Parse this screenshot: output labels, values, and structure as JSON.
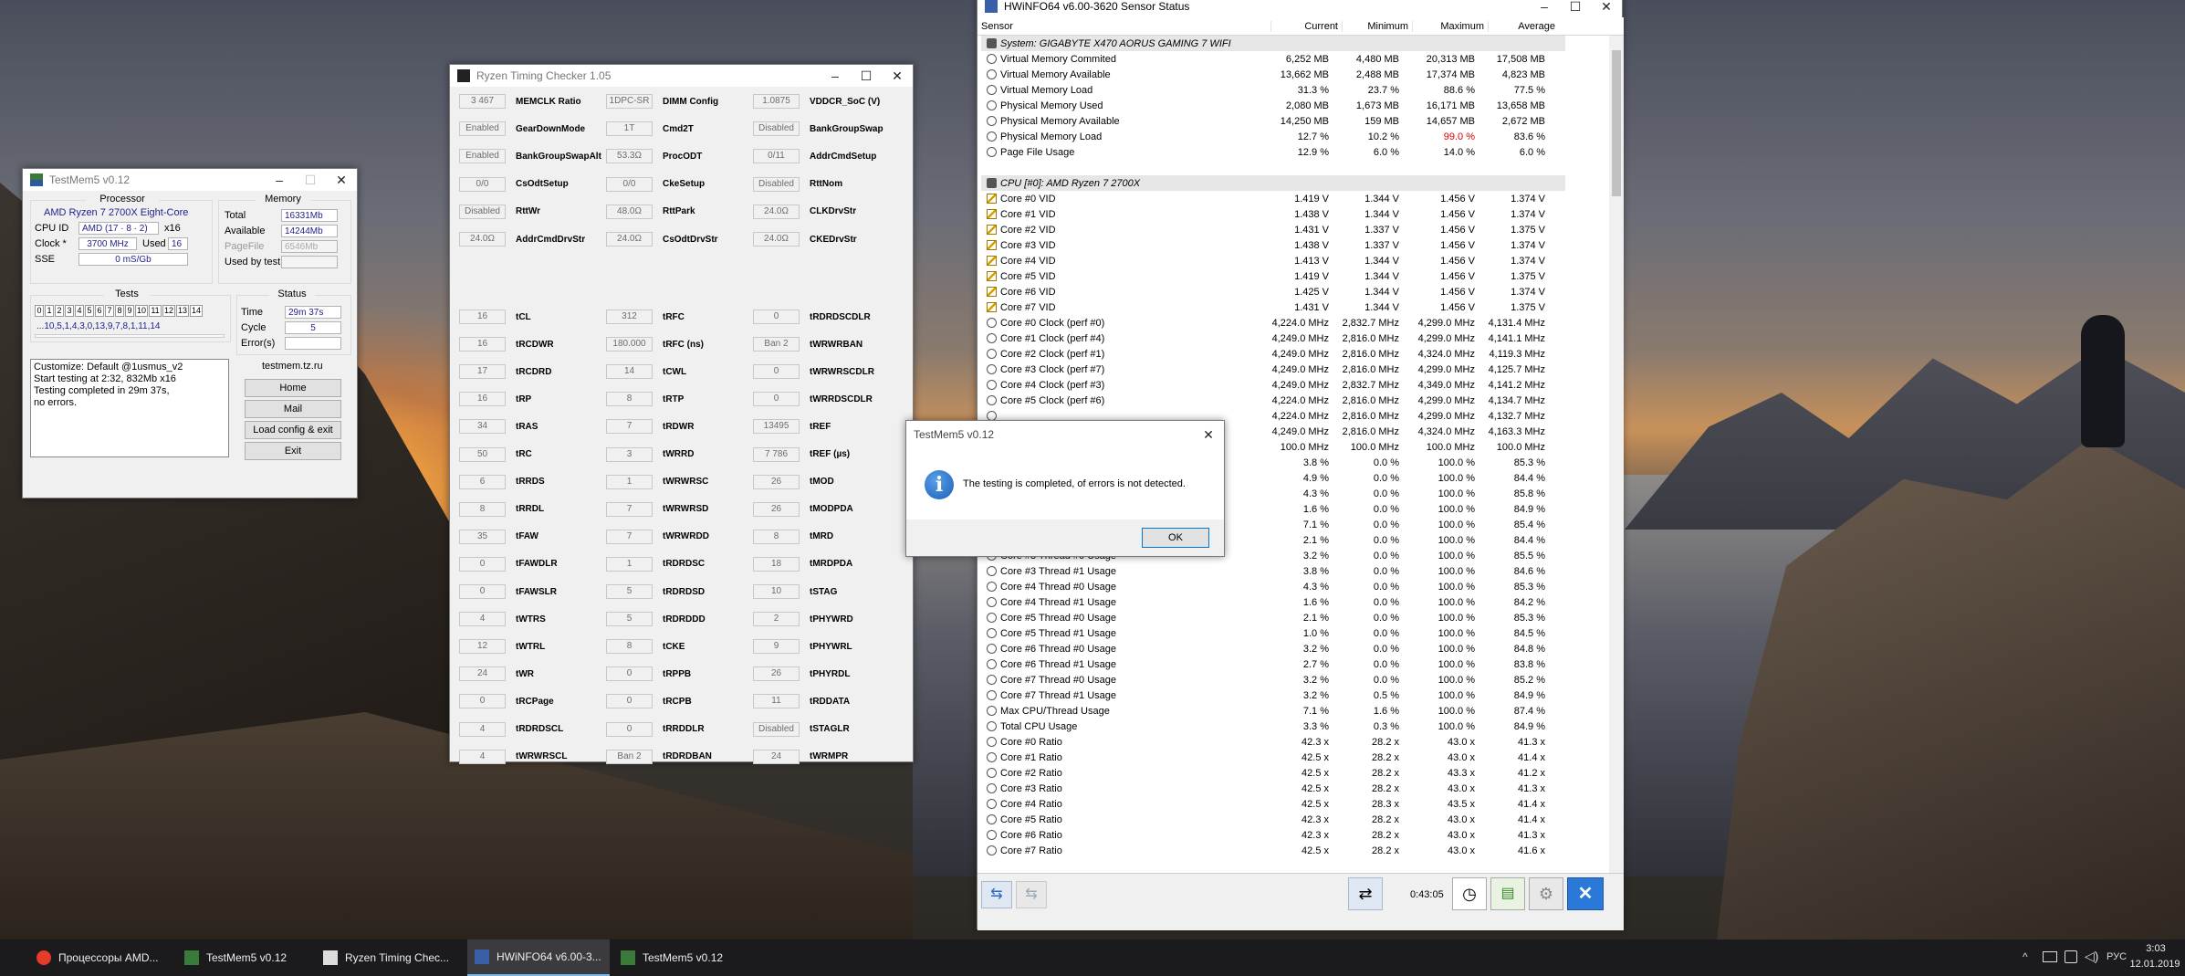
{
  "testmem": {
    "title": "TestMem5 v0.12",
    "processor_label": "Processor",
    "processor_name": "AMD Ryzen 7 2700X Eight-Core",
    "cpuid_label": "CPU ID",
    "cpuid_value": "AMD  (17 · 8 · 2)",
    "cpuid_extra": "x16",
    "clock_label": "Clock *",
    "clock_value": "3700 MHz",
    "used_label": "Used",
    "used_value": "16",
    "sse_label": "SSE",
    "sse_value": "0 mS/Gb",
    "memory_label": "Memory",
    "total_label": "Total",
    "total_value": "16331Mb",
    "available_label": "Available",
    "available_value": "14244Mb",
    "pagefile_label": "PageFile",
    "pagefile_value": "6546Mb",
    "usedbytest_label": "Used by test",
    "usedbytest_value": "",
    "tests_label": "Tests",
    "test_numbers": [
      "0",
      "1",
      "2",
      "3",
      "4",
      "5",
      "6",
      "7",
      "8",
      "9",
      "10",
      "11",
      "12",
      "13",
      "14"
    ],
    "test_sequence": "...10,5,1,4,3,0,13,9,7,8,1,11,14",
    "status_label": "Status",
    "time_label": "Time",
    "time_value": "29m 37s",
    "cycle_label": "Cycle",
    "cycle_value": "5",
    "errors_label": "Error(s)",
    "errors_value": "",
    "log_lines": [
      "Customize: Default @1usmus_v2",
      "Start testing at 2:32, 832Mb x16",
      "Testing completed in 29m 37s,",
      "no errors."
    ],
    "site": "testmem.tz.ru",
    "btn_home": "Home",
    "btn_mail": "Mail",
    "btn_load": "Load config & exit",
    "btn_exit": "Exit"
  },
  "rtc": {
    "title": "Ryzen Timing Checker 1.05",
    "top_rows": [
      [
        [
          "3 467",
          "MEMCLK Ratio"
        ],
        [
          "1DPC-SR",
          "DIMM Config"
        ],
        [
          "1.0875",
          "VDDCR_SoC (V)"
        ]
      ],
      [
        [
          "Enabled",
          "GearDownMode"
        ],
        [
          "1T",
          "Cmd2T"
        ],
        [
          "Disabled",
          "BankGroupSwap"
        ]
      ],
      [
        [
          "Enabled",
          "BankGroupSwapAlt"
        ],
        [
          "53.3Ω",
          "ProcODT"
        ],
        [
          "0/11",
          "AddrCmdSetup"
        ]
      ],
      [
        [
          "0/0",
          "CsOdtSetup"
        ],
        [
          "0/0",
          "CkeSetup"
        ],
        [
          "Disabled",
          "RttNom"
        ]
      ],
      [
        [
          "Disabled",
          "RttWr"
        ],
        [
          "48.0Ω",
          "RttPark"
        ],
        [
          "24.0Ω",
          "CLKDrvStr"
        ]
      ],
      [
        [
          "24.0Ω",
          "AddrCmdDrvStr"
        ],
        [
          "24.0Ω",
          "CsOdtDrvStr"
        ],
        [
          "24.0Ω",
          "CKEDrvStr"
        ]
      ]
    ],
    "timing_rows": [
      [
        [
          "16",
          "tCL"
        ],
        [
          "312",
          "tRFC"
        ],
        [
          "0",
          "tRDRDSCDLR"
        ]
      ],
      [
        [
          "16",
          "tRCDWR"
        ],
        [
          "180.000",
          "tRFC (ns)"
        ],
        [
          "Ban 2",
          "tWRWRBAN"
        ]
      ],
      [
        [
          "17",
          "tRCDRD"
        ],
        [
          "14",
          "tCWL"
        ],
        [
          "0",
          "tWRWRSCDLR"
        ]
      ],
      [
        [
          "16",
          "tRP"
        ],
        [
          "8",
          "tRTP"
        ],
        [
          "0",
          "tWRRDSCDLR"
        ]
      ],
      [
        [
          "34",
          "tRAS"
        ],
        [
          "7",
          "tRDWR"
        ],
        [
          "13495",
          "tREF"
        ]
      ],
      [
        [
          "50",
          "tRC"
        ],
        [
          "3",
          "tWRRD"
        ],
        [
          "7 786",
          "tREF (µs)"
        ]
      ],
      [
        [
          "6",
          "tRRDS"
        ],
        [
          "1",
          "tWRWRSC"
        ],
        [
          "26",
          "tMOD"
        ]
      ],
      [
        [
          "8",
          "tRRDL"
        ],
        [
          "7",
          "tWRWRSD"
        ],
        [
          "26",
          "tMODPDA"
        ]
      ],
      [
        [
          "35",
          "tFAW"
        ],
        [
          "7",
          "tWRWRDD"
        ],
        [
          "8",
          "tMRD"
        ]
      ],
      [
        [
          "0",
          "tFAWDLR"
        ],
        [
          "1",
          "tRDRDSC"
        ],
        [
          "18",
          "tMRDPDA"
        ]
      ],
      [
        [
          "0",
          "tFAWSLR"
        ],
        [
          "5",
          "tRDRDSD"
        ],
        [
          "10",
          "tSTAG"
        ]
      ],
      [
        [
          "4",
          "tWTRS"
        ],
        [
          "5",
          "tRDRDDD"
        ],
        [
          "2",
          "tPHYWRD"
        ]
      ],
      [
        [
          "12",
          "tWTRL"
        ],
        [
          "8",
          "tCKE"
        ],
        [
          "9",
          "tPHYWRL"
        ]
      ],
      [
        [
          "24",
          "tWR"
        ],
        [
          "0",
          "tRPPB"
        ],
        [
          "26",
          "tPHYRDL"
        ]
      ],
      [
        [
          "0",
          "tRCPage"
        ],
        [
          "0",
          "tRCPB"
        ],
        [
          "11",
          "tRDDATA"
        ]
      ],
      [
        [
          "4",
          "tRDRDSCL"
        ],
        [
          "0",
          "tRRDDLR"
        ],
        [
          "Disabled",
          "tSTAGLR"
        ]
      ],
      [
        [
          "4",
          "tWRWRSCL"
        ],
        [
          "Ban 2",
          "tRDRDBAN"
        ],
        [
          "24",
          "tWRMPR"
        ]
      ]
    ]
  },
  "hwinfo": {
    "title": "HWiNFO64 v6.00-3620 Sensor Status",
    "columns": [
      "Sensor",
      "Current",
      "Minimum",
      "Maximum",
      "Average"
    ],
    "rows": [
      {
        "g": 1,
        "name": "System: GIGABYTE X470 AORUS GAMING 7 WIFI"
      },
      {
        "i": "clock",
        "name": "Virtual Memory Commited",
        "v": [
          "6,252 MB",
          "4,480 MB",
          "20,313 MB",
          "17,508 MB"
        ]
      },
      {
        "i": "clock",
        "name": "Virtual Memory Available",
        "v": [
          "13,662 MB",
          "2,488 MB",
          "17,374 MB",
          "4,823 MB"
        ]
      },
      {
        "i": "clock",
        "name": "Virtual Memory Load",
        "v": [
          "31.3 %",
          "23.7 %",
          "88.6 %",
          "77.5 %"
        ]
      },
      {
        "i": "clock",
        "name": "Physical Memory Used",
        "v": [
          "2,080 MB",
          "1,673 MB",
          "16,171 MB",
          "13,658 MB"
        ]
      },
      {
        "i": "clock",
        "name": "Physical Memory Available",
        "v": [
          "14,250 MB",
          "159 MB",
          "14,657 MB",
          "2,672 MB"
        ]
      },
      {
        "i": "clock",
        "name": "Physical Memory Load",
        "v": [
          "12.7 %",
          "10.2 %",
          "99.0 %",
          "83.6 %"
        ],
        "red": 3
      },
      {
        "i": "clock",
        "name": "Page File Usage",
        "v": [
          "12.9 %",
          "6.0 %",
          "14.0 %",
          "6.0 %"
        ]
      },
      {
        "blank": 1
      },
      {
        "g": 1,
        "name": "CPU [#0]: AMD Ryzen 7 2700X"
      },
      {
        "i": "volt",
        "name": "Core #0 VID",
        "v": [
          "1.419 V",
          "1.344 V",
          "1.456 V",
          "1.374 V"
        ]
      },
      {
        "i": "volt",
        "name": "Core #1 VID",
        "v": [
          "1.438 V",
          "1.344 V",
          "1.456 V",
          "1.374 V"
        ]
      },
      {
        "i": "volt",
        "name": "Core #2 VID",
        "v": [
          "1.431 V",
          "1.337 V",
          "1.456 V",
          "1.375 V"
        ]
      },
      {
        "i": "volt",
        "name": "Core #3 VID",
        "v": [
          "1.438 V",
          "1.337 V",
          "1.456 V",
          "1.374 V"
        ]
      },
      {
        "i": "volt",
        "name": "Core #4 VID",
        "v": [
          "1.413 V",
          "1.344 V",
          "1.456 V",
          "1.374 V"
        ]
      },
      {
        "i": "volt",
        "name": "Core #5 VID",
        "v": [
          "1.419 V",
          "1.344 V",
          "1.456 V",
          "1.375 V"
        ]
      },
      {
        "i": "volt",
        "name": "Core #6 VID",
        "v": [
          "1.425 V",
          "1.344 V",
          "1.456 V",
          "1.374 V"
        ]
      },
      {
        "i": "volt",
        "name": "Core #7 VID",
        "v": [
          "1.431 V",
          "1.344 V",
          "1.456 V",
          "1.375 V"
        ]
      },
      {
        "i": "clock",
        "name": "Core #0 Clock (perf #0)",
        "v": [
          "4,224.0 MHz",
          "2,832.7 MHz",
          "4,299.0 MHz",
          "4,131.4 MHz"
        ]
      },
      {
        "i": "clock",
        "name": "Core #1 Clock (perf #4)",
        "v": [
          "4,249.0 MHz",
          "2,816.0 MHz",
          "4,299.0 MHz",
          "4,141.1 MHz"
        ]
      },
      {
        "i": "clock",
        "name": "Core #2 Clock (perf #1)",
        "v": [
          "4,249.0 MHz",
          "2,816.0 MHz",
          "4,324.0 MHz",
          "4,119.3 MHz"
        ]
      },
      {
        "i": "clock",
        "name": "Core #3 Clock (perf #7)",
        "v": [
          "4,249.0 MHz",
          "2,816.0 MHz",
          "4,299.0 MHz",
          "4,125.7 MHz"
        ]
      },
      {
        "i": "clock",
        "name": "Core #4 Clock (perf #3)",
        "v": [
          "4,249.0 MHz",
          "2,832.7 MHz",
          "4,349.0 MHz",
          "4,141.2 MHz"
        ]
      },
      {
        "i": "clock",
        "name": "Core #5 Clock (perf #6)",
        "v": [
          "4,224.0 MHz",
          "2,816.0 MHz",
          "4,299.0 MHz",
          "4,134.7 MHz"
        ]
      },
      {
        "i": "clock",
        "name": "",
        "v": [
          "4,224.0 MHz",
          "2,816.0 MHz",
          "4,299.0 MHz",
          "4,132.7 MHz"
        ]
      },
      {
        "i": "clock",
        "name": "",
        "v": [
          "4,249.0 MHz",
          "2,816.0 MHz",
          "4,324.0 MHz",
          "4,163.3 MHz"
        ]
      },
      {
        "i": "clock",
        "name": "",
        "v": [
          "100.0 MHz",
          "100.0 MHz",
          "100.0 MHz",
          "100.0 MHz"
        ]
      },
      {
        "i": "clock",
        "name": "",
        "v": [
          "3.8 %",
          "0.0 %",
          "100.0 %",
          "85.3 %"
        ]
      },
      {
        "i": "clock",
        "name": "",
        "v": [
          "4.9 %",
          "0.0 %",
          "100.0 %",
          "84.4 %"
        ]
      },
      {
        "i": "clock",
        "name": "",
        "v": [
          "4.3 %",
          "0.0 %",
          "100.0 %",
          "85.8 %"
        ]
      },
      {
        "i": "clock",
        "name": "",
        "v": [
          "1.6 %",
          "0.0 %",
          "100.0 %",
          "84.9 %"
        ]
      },
      {
        "i": "clock",
        "name": "",
        "v": [
          "7.1 %",
          "0.0 %",
          "100.0 %",
          "85.4 %"
        ]
      },
      {
        "i": "clock",
        "name": "",
        "v": [
          "2.1 %",
          "0.0 %",
          "100.0 %",
          "84.4 %"
        ]
      },
      {
        "i": "clock",
        "name": "Core #3 Thread #0 Usage",
        "v": [
          "3.2 %",
          "0.0 %",
          "100.0 %",
          "85.5 %"
        ]
      },
      {
        "i": "clock",
        "name": "Core #3 Thread #1 Usage",
        "v": [
          "3.8 %",
          "0.0 %",
          "100.0 %",
          "84.6 %"
        ]
      },
      {
        "i": "clock",
        "name": "Core #4 Thread #0 Usage",
        "v": [
          "4.3 %",
          "0.0 %",
          "100.0 %",
          "85.3 %"
        ]
      },
      {
        "i": "clock",
        "name": "Core #4 Thread #1 Usage",
        "v": [
          "1.6 %",
          "0.0 %",
          "100.0 %",
          "84.2 %"
        ]
      },
      {
        "i": "clock",
        "name": "Core #5 Thread #0 Usage",
        "v": [
          "2.1 %",
          "0.0 %",
          "100.0 %",
          "85.3 %"
        ]
      },
      {
        "i": "clock",
        "name": "Core #5 Thread #1 Usage",
        "v": [
          "1.0 %",
          "0.0 %",
          "100.0 %",
          "84.5 %"
        ]
      },
      {
        "i": "clock",
        "name": "Core #6 Thread #0 Usage",
        "v": [
          "3.2 %",
          "0.0 %",
          "100.0 %",
          "84.8 %"
        ]
      },
      {
        "i": "clock",
        "name": "Core #6 Thread #1 Usage",
        "v": [
          "2.7 %",
          "0.0 %",
          "100.0 %",
          "83.8 %"
        ]
      },
      {
        "i": "clock",
        "name": "Core #7 Thread #0 Usage",
        "v": [
          "3.2 %",
          "0.0 %",
          "100.0 %",
          "85.2 %"
        ]
      },
      {
        "i": "clock",
        "name": "Core #7 Thread #1 Usage",
        "v": [
          "3.2 %",
          "0.5 %",
          "100.0 %",
          "84.9 %"
        ]
      },
      {
        "i": "clock",
        "name": "Max CPU/Thread Usage",
        "v": [
          "7.1 %",
          "1.6 %",
          "100.0 %",
          "87.4 %"
        ]
      },
      {
        "i": "clock",
        "name": "Total CPU Usage",
        "v": [
          "3.3 %",
          "0.3 %",
          "100.0 %",
          "84.9 %"
        ]
      },
      {
        "i": "clock",
        "name": "Core #0 Ratio",
        "v": [
          "42.3 x",
          "28.2 x",
          "43.0 x",
          "41.3 x"
        ]
      },
      {
        "i": "clock",
        "name": "Core #1 Ratio",
        "v": [
          "42.5 x",
          "28.2 x",
          "43.0 x",
          "41.4 x"
        ]
      },
      {
        "i": "clock",
        "name": "Core #2 Ratio",
        "v": [
          "42.5 x",
          "28.2 x",
          "43.3 x",
          "41.2 x"
        ]
      },
      {
        "i": "clock",
        "name": "Core #3 Ratio",
        "v": [
          "42.5 x",
          "28.2 x",
          "43.0 x",
          "41.3 x"
        ]
      },
      {
        "i": "clock",
        "name": "Core #4 Ratio",
        "v": [
          "42.5 x",
          "28.3 x",
          "43.5 x",
          "41.4 x"
        ]
      },
      {
        "i": "clock",
        "name": "Core #5 Ratio",
        "v": [
          "42.3 x",
          "28.2 x",
          "43.0 x",
          "41.4 x"
        ]
      },
      {
        "i": "clock",
        "name": "Core #6 Ratio",
        "v": [
          "42.3 x",
          "28.2 x",
          "43.0 x",
          "41.3 x"
        ]
      },
      {
        "i": "clock",
        "name": "Core #7 Ratio",
        "v": [
          "42.5 x",
          "28.2 x",
          "43.0 x",
          "41.6 x"
        ]
      }
    ],
    "elapsed": "0:43:05"
  },
  "dialog": {
    "title": "TestMem5 v0.12",
    "message": "The testing is completed, of errors is not detected.",
    "ok": "OK"
  },
  "taskbar": {
    "items": [
      {
        "label": "Процессоры AMD...",
        "icon": "yandex-browser-icon"
      },
      {
        "label": "TestMem5 v0.12",
        "icon": "testmem-icon"
      },
      {
        "label": "Ryzen Timing Chec...",
        "icon": "rtc-icon"
      },
      {
        "label": "HWiNFO64 v6.00-3...",
        "icon": "hwinfo-icon"
      },
      {
        "label": "TestMem5 v0.12",
        "icon": "testmem-icon"
      }
    ],
    "tray": {
      "caret": "^",
      "lang": "РУС",
      "time": "3:03",
      "date": "12.01.2019"
    }
  },
  "colors": {
    "accent": "#0078d7",
    "field_text": "#22228c",
    "alert_red": "#e00000"
  }
}
